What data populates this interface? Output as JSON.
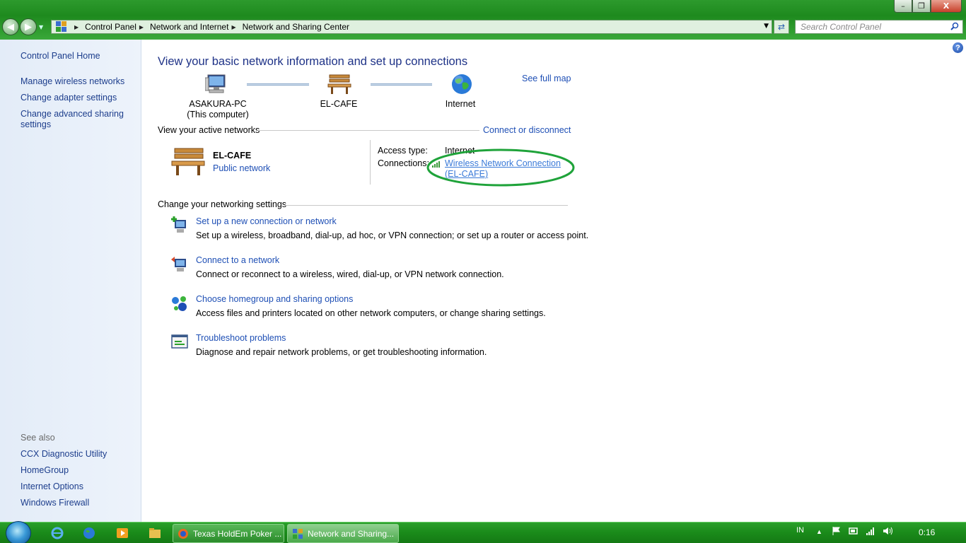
{
  "window": {
    "minimize_label": "–",
    "restore_label": "❐",
    "close_label": "X"
  },
  "address_bar": {
    "breadcrumbs": [
      "Control Panel",
      "Network and Internet",
      "Network and Sharing Center"
    ],
    "search_placeholder": "Search Control Panel"
  },
  "sidebar": {
    "home": "Control Panel Home",
    "links": [
      "Manage wireless networks",
      "Change adapter settings",
      "Change advanced sharing",
      "settings"
    ],
    "see_also_title": "See also",
    "see_also": [
      "CCX Diagnostic Utility",
      "HomeGroup",
      "Internet Options",
      "Windows Firewall"
    ]
  },
  "main": {
    "title": "View your basic network information and set up connections",
    "see_full_map": "See full map",
    "map": {
      "computer_name": "ASAKURA-PC",
      "computer_sub": "(This computer)",
      "network": "EL-CAFE",
      "internet": "Internet"
    },
    "active_networks": {
      "title": "View your active networks",
      "connect_link": "Connect or disconnect",
      "network_name": "EL-CAFE",
      "network_type": "Public network",
      "access_type_label": "Access type:",
      "access_type_value": "Internet",
      "connections_label": "Connections:",
      "connection_line1": "Wireless Network Connection",
      "connection_line2": "(EL-CAFE)"
    },
    "settings": {
      "title": "Change your networking settings",
      "tasks": [
        {
          "title": "Set up a new connection or network",
          "desc": "Set up a wireless, broadband, dial-up, ad hoc, or VPN connection; or set up a router or access point."
        },
        {
          "title": "Connect to a network",
          "desc": "Connect or reconnect to a wireless, wired, dial-up, or VPN network connection."
        },
        {
          "title": "Choose homegroup and sharing options",
          "desc": "Access files and printers located on other network computers, or change sharing settings."
        },
        {
          "title": "Troubleshoot problems",
          "desc": "Diagnose and repair network problems, or get troubleshooting information."
        }
      ]
    }
  },
  "taskbar": {
    "apps": [
      "Texas HoldEm Poker ...",
      "Network and Sharing..."
    ],
    "language": "IN",
    "clock": "0:16"
  },
  "colors": {
    "link": "#1e4fb5",
    "title": "#1e3287",
    "annotation_circle": "#1fa33a",
    "chrome_green": "#1e8a1e"
  }
}
